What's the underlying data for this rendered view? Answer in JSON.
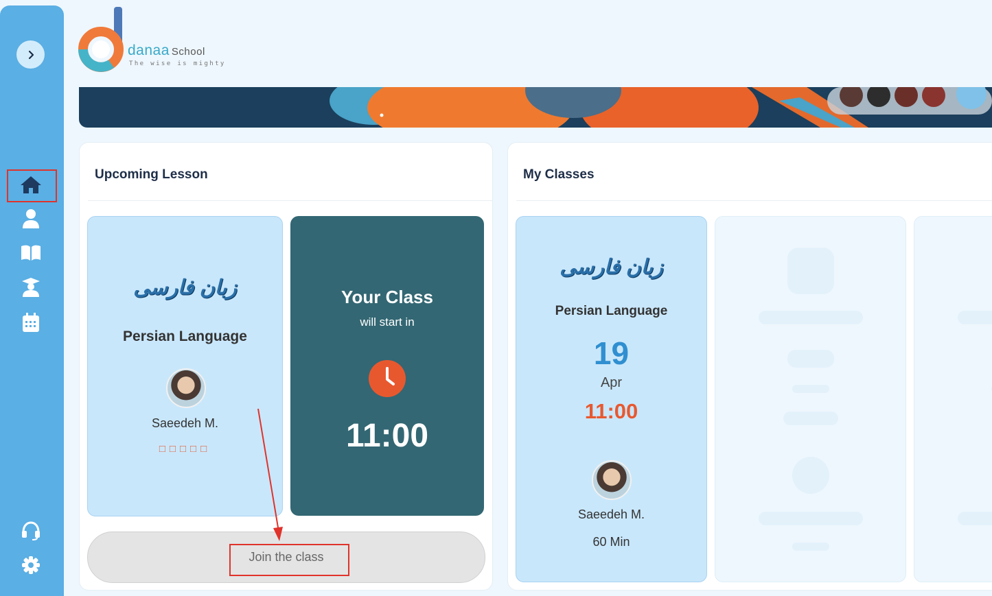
{
  "logo": {
    "word": "danaa",
    "school": "School",
    "tagline": "The wise is mighty"
  },
  "sidebar": {
    "toggle_icon": "chevron-right-icon",
    "items": [
      {
        "icon": "home-icon",
        "active": true
      },
      {
        "icon": "user-icon"
      },
      {
        "icon": "book-icon"
      },
      {
        "icon": "teacher-icon"
      },
      {
        "icon": "calendar-icon"
      }
    ],
    "bottom": [
      {
        "icon": "headset-icon"
      },
      {
        "icon": "gear-icon"
      }
    ]
  },
  "upcoming": {
    "title": "Upcoming Lesson",
    "course_title": "Persian Language",
    "course_logo_text": "زبان فارسی",
    "teacher": "Saeedeh M.",
    "stars": "□□□□□",
    "countdown_title": "Your Class",
    "countdown_subtitle": "will start in",
    "time": "11:00",
    "join_label": "Join the class"
  },
  "my_classes": {
    "title": "My Classes",
    "card": {
      "course_title": "Persian Language",
      "course_logo_text": "زبان فارسی",
      "day": "19",
      "month": "Apr",
      "time": "11:00",
      "teacher": "Saeedeh M.",
      "duration": "60 Min"
    }
  },
  "colors": {
    "sidebar": "#5aafe4",
    "accent_orange": "#e8582f",
    "date_blue": "#2f8fd0",
    "countdown_bg": "#336773",
    "highlight_red": "#e0332b"
  }
}
